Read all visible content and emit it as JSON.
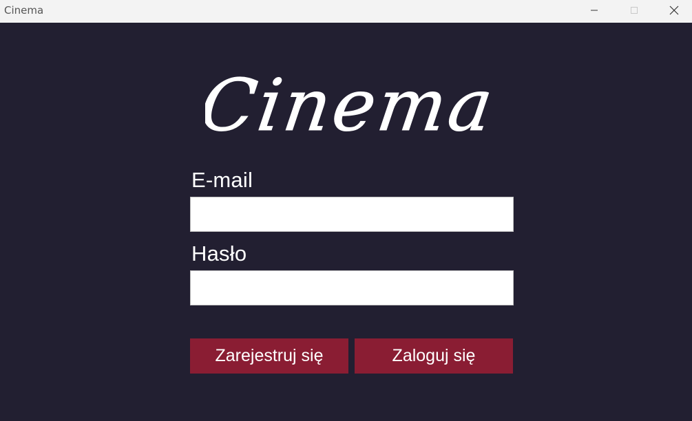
{
  "window": {
    "title": "Cinema",
    "controls": {
      "minimize_icon": "minimize-icon",
      "maximize_icon": "maximize-icon",
      "close_icon": "close-icon"
    }
  },
  "logo": {
    "text": "Cinema"
  },
  "form": {
    "email_label": "E-mail",
    "email_value": "",
    "password_label": "Hasło",
    "password_value": "",
    "register_label": "Zarejestruj się",
    "login_label": "Zaloguj się"
  },
  "colors": {
    "background": "#221f31",
    "titlebar": "#f3f3f3",
    "button": "#8a1d33",
    "text": "#ffffff"
  }
}
